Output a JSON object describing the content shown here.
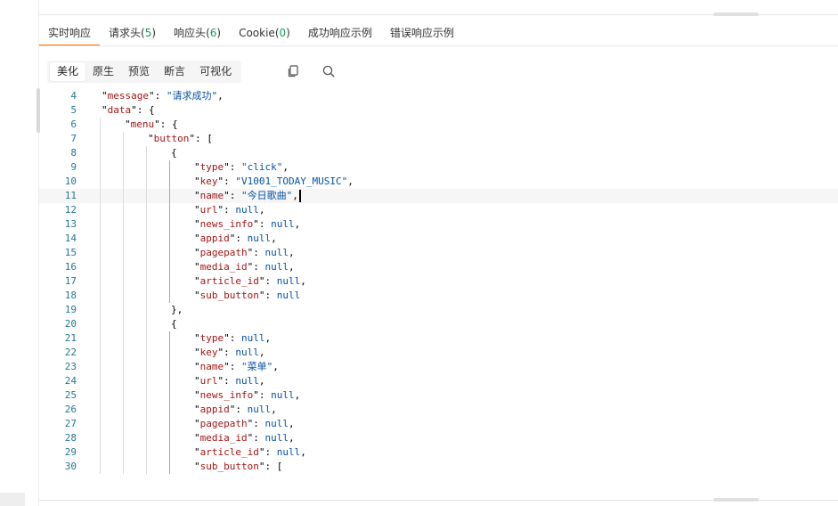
{
  "response_tabs": [
    {
      "label": "实时响应",
      "count": null,
      "active": true
    },
    {
      "label": "请求头",
      "count": "5",
      "active": false
    },
    {
      "label": "响应头",
      "count": "6",
      "active": false
    },
    {
      "label": "Cookie",
      "count": "0",
      "active": false
    },
    {
      "label": "成功响应示例",
      "count": null,
      "active": false
    },
    {
      "label": "错误响应示例",
      "count": null,
      "active": false
    }
  ],
  "view_modes": [
    {
      "label": "美化",
      "active": true
    },
    {
      "label": "原生",
      "active": false
    },
    {
      "label": "预览",
      "active": false
    },
    {
      "label": "断言",
      "active": false
    },
    {
      "label": "可视化",
      "active": false
    }
  ],
  "toolbar_icons": {
    "copy": "copy-icon",
    "search": "search-icon"
  },
  "editor": {
    "current_line": 11,
    "lines": [
      {
        "n": "4",
        "indent": 1,
        "key": "message",
        "val": "\"请求成功\"",
        "vt": "s",
        "tail": ","
      },
      {
        "n": "5",
        "indent": 1,
        "key": "data",
        "val": "{",
        "vt": "p",
        "tail": ""
      },
      {
        "n": "6",
        "indent": 2,
        "key": "menu",
        "val": "{",
        "vt": "p",
        "tail": ""
      },
      {
        "n": "7",
        "indent": 3,
        "key": "button",
        "val": "[",
        "vt": "p",
        "tail": ""
      },
      {
        "n": "8",
        "indent": 4,
        "key": null,
        "val": "{",
        "vt": "p",
        "tail": ""
      },
      {
        "n": "9",
        "indent": 5,
        "key": "type",
        "val": "\"click\"",
        "vt": "s",
        "tail": ","
      },
      {
        "n": "10",
        "indent": 5,
        "key": "key",
        "val": "\"V1001_TODAY_MUSIC\"",
        "vt": "s",
        "tail": ","
      },
      {
        "n": "11",
        "indent": 5,
        "key": "name",
        "val": "\"今日歌曲\"",
        "vt": "s",
        "tail": ","
      },
      {
        "n": "12",
        "indent": 5,
        "key": "url",
        "val": "null",
        "vt": "n",
        "tail": ","
      },
      {
        "n": "13",
        "indent": 5,
        "key": "news_info",
        "val": "null",
        "vt": "n",
        "tail": ","
      },
      {
        "n": "14",
        "indent": 5,
        "key": "appid",
        "val": "null",
        "vt": "n",
        "tail": ","
      },
      {
        "n": "15",
        "indent": 5,
        "key": "pagepath",
        "val": "null",
        "vt": "n",
        "tail": ","
      },
      {
        "n": "16",
        "indent": 5,
        "key": "media_id",
        "val": "null",
        "vt": "n",
        "tail": ","
      },
      {
        "n": "17",
        "indent": 5,
        "key": "article_id",
        "val": "null",
        "vt": "n",
        "tail": ","
      },
      {
        "n": "18",
        "indent": 5,
        "key": "sub_button",
        "val": "null",
        "vt": "n",
        "tail": ""
      },
      {
        "n": "19",
        "indent": 4,
        "key": null,
        "val": "}",
        "vt": "p",
        "tail": ","
      },
      {
        "n": "20",
        "indent": 4,
        "key": null,
        "val": "{",
        "vt": "p",
        "tail": ""
      },
      {
        "n": "21",
        "indent": 5,
        "key": "type",
        "val": "null",
        "vt": "n",
        "tail": ","
      },
      {
        "n": "22",
        "indent": 5,
        "key": "key",
        "val": "null",
        "vt": "n",
        "tail": ","
      },
      {
        "n": "23",
        "indent": 5,
        "key": "name",
        "val": "\"菜单\"",
        "vt": "s",
        "tail": ","
      },
      {
        "n": "24",
        "indent": 5,
        "key": "url",
        "val": "null",
        "vt": "n",
        "tail": ","
      },
      {
        "n": "25",
        "indent": 5,
        "key": "news_info",
        "val": "null",
        "vt": "n",
        "tail": ","
      },
      {
        "n": "26",
        "indent": 5,
        "key": "appid",
        "val": "null",
        "vt": "n",
        "tail": ","
      },
      {
        "n": "27",
        "indent": 5,
        "key": "pagepath",
        "val": "null",
        "vt": "n",
        "tail": ","
      },
      {
        "n": "28",
        "indent": 5,
        "key": "media_id",
        "val": "null",
        "vt": "n",
        "tail": ","
      },
      {
        "n": "29",
        "indent": 5,
        "key": "article_id",
        "val": "null",
        "vt": "n",
        "tail": ","
      },
      {
        "n": "30",
        "indent": 5,
        "key": "sub_button",
        "val": "[",
        "vt": "p",
        "tail": ""
      }
    ]
  },
  "colors": {
    "active_tab_underline": "#ff6a00",
    "count_green": "#1a9b5a",
    "json_key": "#a31515",
    "json_value": "#0451a5",
    "line_number": "#237893"
  }
}
